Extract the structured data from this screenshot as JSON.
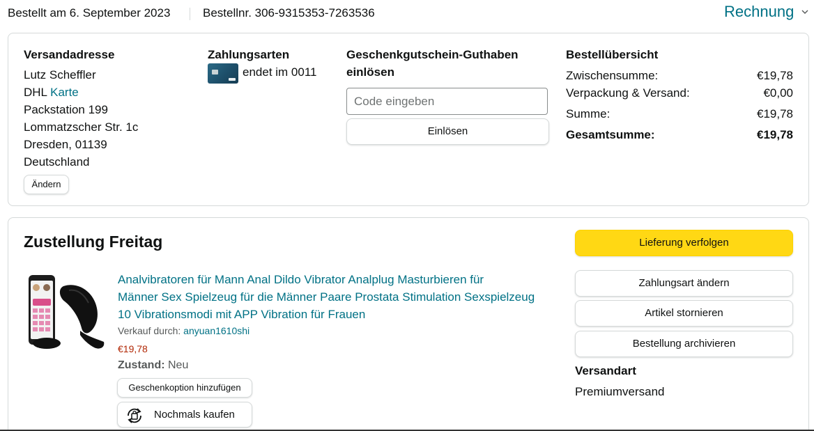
{
  "header": {
    "order_date": "Bestellt am 6. September 2023",
    "order_number": "Bestellnr. 306-9315353-7263536",
    "invoice_label": "Rechnung",
    "invoice_icon": "chevron-down-icon"
  },
  "summary_card": {
    "shipping": {
      "heading": "Versandadresse",
      "name": "Lutz Scheffler",
      "carrier": "DHL",
      "map_link": "Karte",
      "line3": "Packstation 199",
      "line4": "Lommatzscher Str. 1c",
      "line5": "Dresden, 01139",
      "line6": "Deutschland",
      "change_button": "Ändern"
    },
    "payment": {
      "heading": "Zahlungsarten",
      "card_text": "endet im 0011",
      "card_icon": "credit-card-icon"
    },
    "gift": {
      "heading_line1": "Geschenkgutschein-Guthaben",
      "heading_line2": "einlösen",
      "input_placeholder": "Code eingeben",
      "input_value": "",
      "redeem_button": "Einlösen"
    },
    "overview": {
      "heading": "Bestellübersicht",
      "rows": [
        {
          "label": "Zwischensumme:",
          "value": "€19,78"
        },
        {
          "label": "Verpackung & Versand:",
          "value": "€0,00"
        },
        {
          "label": "Summe:",
          "value": "€19,78"
        }
      ],
      "total": {
        "label": "Gesamtsumme:",
        "value": "€19,78"
      }
    }
  },
  "delivery_card": {
    "title": "Zustellung Freitag",
    "product": {
      "title_line1": "Analvibratoren für Mann Anal Dildo Vibrator Analplug Masturbieren für",
      "title_line2": "Männer Sex Spielzeug für die Männer Paare Prostata Stimulation Sexspielzeug",
      "title_line3": "10 Vibrationsmodi mit APP Vibration für Frauen",
      "seller_prefix": "Verkauf durch:",
      "seller_name": "anyuan1610shi",
      "price": "€19,78",
      "condition_label": "Zustand:",
      "condition_value": "Neu",
      "gift_option_button": "Geschenkoption hinzufügen",
      "buy_again_button": "Nochmals kaufen",
      "buy_again_icon": "rebuy-icon"
    },
    "actions": {
      "track": "Lieferung verfolgen",
      "change_payment": "Zahlungsart ändern",
      "cancel_items": "Artikel stornieren",
      "archive_order": "Bestellung archivieren"
    },
    "shipping_method": {
      "heading": "Versandart",
      "value": "Premiumversand"
    }
  },
  "colors": {
    "link": "#007185",
    "primary_button": "#ffd814",
    "price": "#b12704",
    "border": "#d5d9d9"
  }
}
